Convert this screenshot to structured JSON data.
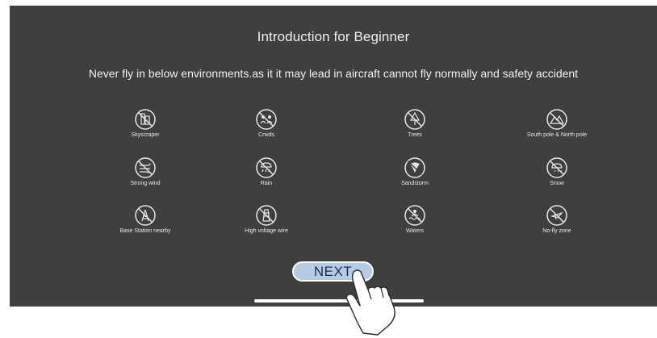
{
  "title": "Introduction for Beginner",
  "warning": "Never fly in below environments.as it it may lead in aircraft cannot fly normally and safety accident",
  "environments": [
    {
      "label": "Skyscraper",
      "icon": "skyscraper-icon"
    },
    {
      "label": "Crwds",
      "icon": "crowds-icon"
    },
    {
      "label": "Trees",
      "icon": "trees-icon"
    },
    {
      "label": "South pole & North pole",
      "icon": "mountain-icon"
    },
    {
      "label": "Strong wind",
      "icon": "wind-icon"
    },
    {
      "label": "Rain",
      "icon": "rain-icon"
    },
    {
      "label": "Sandstorm",
      "icon": "sandstorm-icon"
    },
    {
      "label": "Snow",
      "icon": "snow-icon"
    },
    {
      "label": "Base Station nearby",
      "icon": "base-station-icon"
    },
    {
      "label": "High voltage wire",
      "icon": "power-tower-icon"
    },
    {
      "label": "Waters",
      "icon": "waters-icon"
    },
    {
      "label": "No-fly zone",
      "icon": "no-fly-zone-icon"
    }
  ],
  "next_button": {
    "label": "NEXT"
  },
  "colors": {
    "background": "#3f3f3f",
    "text": "#f0f0f0",
    "button_fill": "#b6cbe6",
    "button_text": "#1e2b58"
  }
}
